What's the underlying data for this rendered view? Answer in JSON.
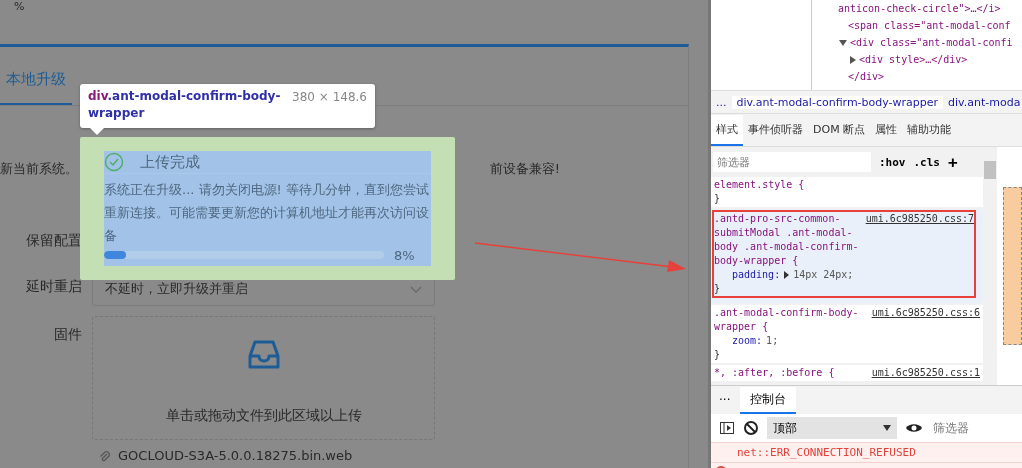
{
  "page": {
    "top_fragment": "%",
    "tabs": [
      {
        "label": "本地升级",
        "selected": true
      }
    ],
    "notice_left": "新当前系统。",
    "notice_right": "前设备兼容!",
    "form": [
      {
        "kind": "text",
        "label": "保留配置"
      },
      {
        "kind": "select",
        "label": "延时重启",
        "value": "不延时，立即升级并重启"
      },
      {
        "kind": "upload",
        "label": "固件",
        "hint": "单击或拖动文件到此区域以上传"
      }
    ],
    "file": "GOCLOUD-S3A-5.0.0.18275.bin.web"
  },
  "modal": {
    "title": "上传完成",
    "message": "系统正在升级... 请勿关闭电源! 等待几分钟，直到您尝试重新连接。可能需要更新您的计算机地址才能再次访问设备",
    "progress": {
      "level": 0.08,
      "reading": "8%"
    }
  },
  "inspect_tooltip": {
    "tag": "div",
    "class_name": ".ant-modal-confirm-body-wrapper",
    "size": "380 × 148.6"
  },
  "devtools": {
    "dom_lines": [
      {
        "kind": "continuation",
        "text": "anticon-check-circle\">…</i>"
      },
      {
        "kind": "leaf",
        "text": "<span class=\"ant-modal-conf"
      },
      {
        "kind": "node",
        "expanded": true,
        "text": "<div class=\"ant-modal-confi",
        "children": [
          {
            "kind": "node",
            "expanded": false,
            "text": "<div style>…</div>"
          }
        ]
      },
      {
        "kind": "close",
        "text": "</div>"
      }
    ],
    "breadcrumbs": [
      {
        "label": "...",
        "selected": false
      },
      {
        "label": "div.ant-modal-confirm-body-wrapper",
        "selected": true
      },
      {
        "label": "div.ant-moda",
        "selected": false
      }
    ],
    "tabs": [
      {
        "label": "样式",
        "selected": true
      },
      {
        "label": "事件侦听器",
        "selected": false
      },
      {
        "label": "DOM 断点",
        "selected": false
      },
      {
        "label": "属性",
        "selected": false
      },
      {
        "label": "辅助功能",
        "selected": false
      }
    ],
    "filter_placeholder": "筛选器",
    "hov": ":hov",
    "cls": ".cls",
    "plus": "+",
    "rules": [
      {
        "selector": "element.style {",
        "close": "}",
        "selected": false,
        "annotated": false
      },
      {
        "selector": ".antd-pro-src-common-submitModal .ant-modal-body .ant-modal-confirm-body-wrapper {",
        "source": "umi.6c985250.css:7",
        "declarations": [
          {
            "property": "padding:",
            "value": "14px 24px;",
            "shorthand": true
          }
        ],
        "close": "}",
        "selected": true,
        "annotated": true
      },
      {
        "selector": ".ant-modal-confirm-body-wrapper {",
        "source": "umi.6c985250.css:6",
        "declarations": [
          {
            "property": "zoom:",
            "value": "1;",
            "shorthand": false
          }
        ],
        "close": "}",
        "selected": false,
        "annotated": false
      },
      {
        "selector": "*, :after, :before {",
        "source": "umi.6c985250.css:1",
        "selected": false,
        "annotated": false
      }
    ],
    "drawer": {
      "more": "···",
      "tabs": [
        {
          "label": "控制台",
          "selected": true
        }
      ],
      "context": "顶部",
      "filter_placeholder": "筛选器",
      "messages": [
        {
          "kind": "error-detail",
          "text": "net::ERR_CONNECTION_REFUSED"
        }
      ]
    }
  }
}
